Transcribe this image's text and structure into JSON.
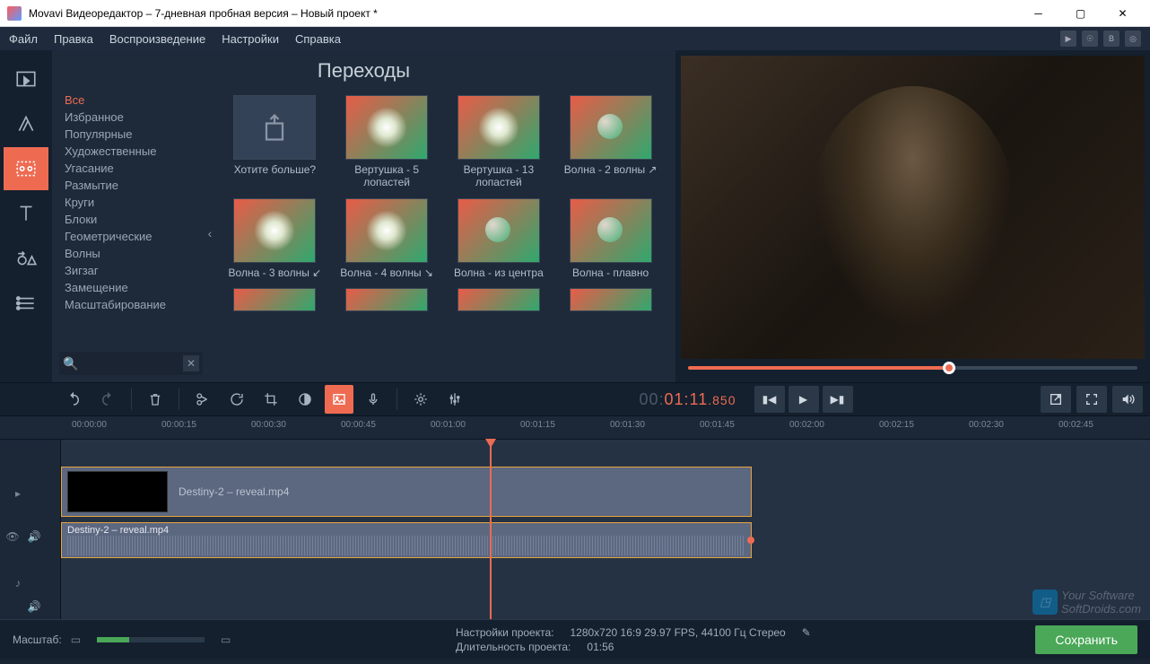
{
  "titlebar": {
    "title": "Movavi Видеоредактор – 7-дневная пробная версия – Новый проект *"
  },
  "menubar": {
    "file": "Файл",
    "edit": "Правка",
    "playback": "Воспроизведение",
    "settings": "Настройки",
    "help": "Справка"
  },
  "browser": {
    "title": "Переходы",
    "categories": [
      "Все",
      "Избранное",
      "Популярные",
      "Художественные",
      "Угасание",
      "Размытие",
      "Круги",
      "Блоки",
      "Геометрические",
      "Волны",
      "Зигзаг",
      "Замещение",
      "Масштабирование"
    ],
    "active_category": 0,
    "thumbs": [
      {
        "label": "Хотите больше?",
        "more": true
      },
      {
        "label": "Вертушка - 5 лопастей"
      },
      {
        "label": "Вертушка - 13 лопастей"
      },
      {
        "label": "Волна - 2 волны ↗"
      },
      {
        "label": "Волна - 3 волны ↙"
      },
      {
        "label": "Волна - 4 волны ↘"
      },
      {
        "label": "Волна - из центра"
      },
      {
        "label": "Волна - плавно"
      }
    ]
  },
  "playback": {
    "timecode_pre": "00:",
    "timecode_main": "01:11",
    "timecode_ms": ".850"
  },
  "ruler_ticks": [
    "00:00:00",
    "00:00:15",
    "00:00:30",
    "00:00:45",
    "00:01:00",
    "00:01:15",
    "00:01:30",
    "00:01:45",
    "00:02:00",
    "00:02:15",
    "00:02:30",
    "00:02:45"
  ],
  "timeline": {
    "video_clip": "Destiny-2 – reveal.mp4",
    "audio_clip": "Destiny-2 – reveal.mp4"
  },
  "status": {
    "zoom_label": "Масштаб:",
    "project_settings_label": "Настройки проекта:",
    "project_settings_value": "1280x720 16:9 29.97 FPS, 44100 Гц Стерео",
    "project_duration_label": "Длительность проекта:",
    "project_duration_value": "01:56",
    "save_label": "Сохранить"
  },
  "watermark": {
    "line1": "Your Software",
    "line2": "SoftDroids.com"
  }
}
